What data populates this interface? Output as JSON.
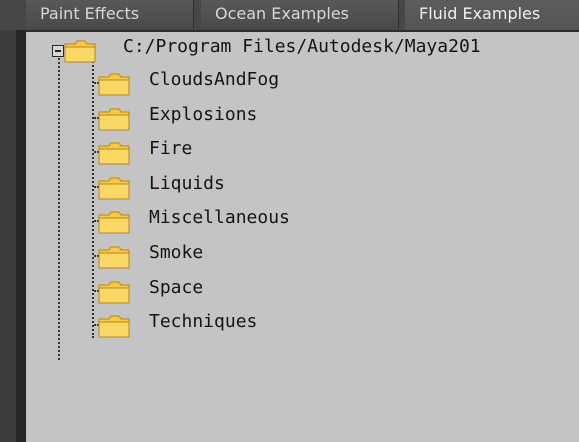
{
  "tabs": [
    {
      "label": "Paint Effects",
      "active": false
    },
    {
      "label": "Ocean Examples",
      "active": false
    },
    {
      "label": "Fluid Examples",
      "active": true
    }
  ],
  "tree": {
    "root": {
      "label": "C:/Program Files/Autodesk/Maya201",
      "icon": "folder-open-icon",
      "expanded": true
    },
    "children": [
      {
        "label": "CloudsAndFog",
        "icon": "folder-icon"
      },
      {
        "label": "Explosions",
        "icon": "folder-icon"
      },
      {
        "label": "Fire",
        "icon": "folder-icon"
      },
      {
        "label": "Liquids",
        "icon": "folder-icon"
      },
      {
        "label": "Miscellaneous",
        "icon": "folder-icon"
      },
      {
        "label": "Smoke",
        "icon": "folder-icon"
      },
      {
        "label": "Space",
        "icon": "folder-icon"
      },
      {
        "label": "Techniques",
        "icon": "folder-icon"
      }
    ]
  },
  "colors": {
    "panel_background": "#c4c4c4",
    "folder_yellow": "#f7c843",
    "tab_background": "#4a4a4a",
    "tab_text": "#d8d8d8"
  }
}
